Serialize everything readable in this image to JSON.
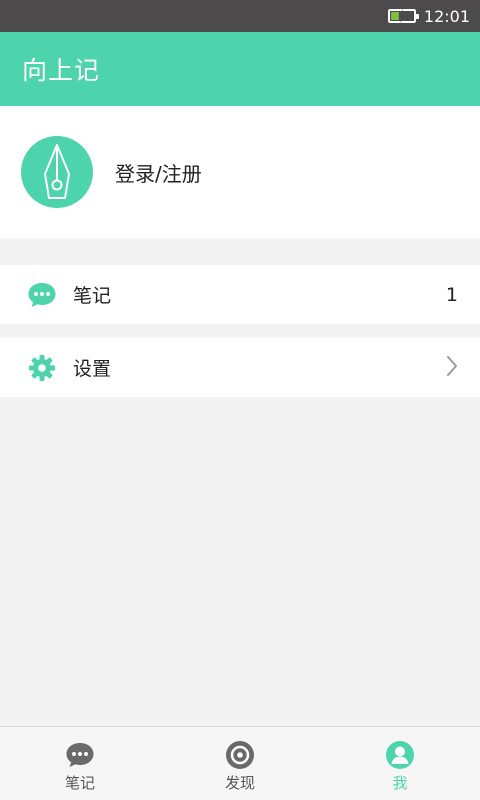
{
  "status_bar": {
    "time": "12:01",
    "battery_level": 0.35
  },
  "app_bar": {
    "title": "向上记"
  },
  "profile": {
    "avatar_icon": "pen-nib-icon",
    "login_label": "登录/注册"
  },
  "menu": {
    "notes": {
      "icon": "chat-bubble-icon",
      "label": "笔记",
      "count": "1"
    },
    "settings": {
      "icon": "gear-icon",
      "label": "设置",
      "chevron": "chevron-right-icon"
    }
  },
  "bottom_nav": {
    "items": [
      {
        "label": "笔记",
        "icon": "chat-bubble-icon",
        "active": false
      },
      {
        "label": "发现",
        "icon": "discover-icon",
        "active": false
      },
      {
        "label": "我",
        "icon": "person-icon",
        "active": true
      }
    ]
  },
  "colors": {
    "accent": "#4dd4ad",
    "status_bar": "#4c4a4b",
    "background": "#f3f3f3",
    "inactive_icon": "#6a6a6a"
  }
}
